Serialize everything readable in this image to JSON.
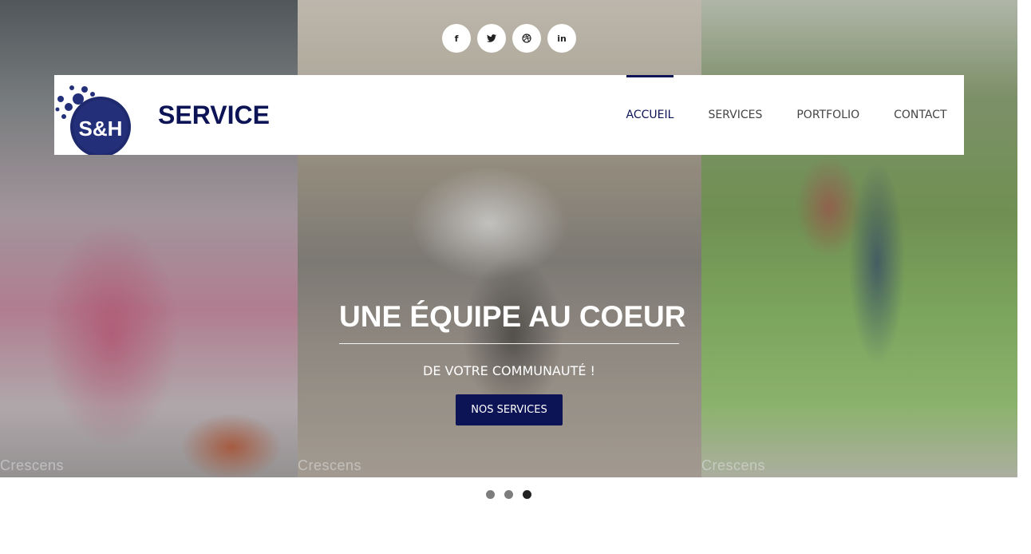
{
  "social": {
    "items": [
      {
        "icon": "facebook-icon",
        "glyph": "f"
      },
      {
        "icon": "twitter-icon",
        "glyph": "🐦"
      },
      {
        "icon": "dribbble-icon",
        "glyph": "◎"
      },
      {
        "icon": "linkedin-icon",
        "glyph": "in"
      }
    ]
  },
  "brand": {
    "logo_text": "S&H",
    "name": "SERVICE"
  },
  "nav": {
    "items": [
      "ACCUEIL",
      "SERVICES",
      "PORTFOLIO",
      "CONTACT"
    ],
    "active": "ACCUEIL"
  },
  "hero": {
    "title": "UNE ÉQUIPE AU COEUR",
    "subtitle": "DE VOTRE COMMUNAUTÉ !",
    "cta_label": "NOS SERVICES",
    "watermark": "Crescens",
    "slide_count": 3,
    "active_slide": 3
  },
  "colors": {
    "primary": "#0d1456",
    "white": "#ffffff"
  }
}
